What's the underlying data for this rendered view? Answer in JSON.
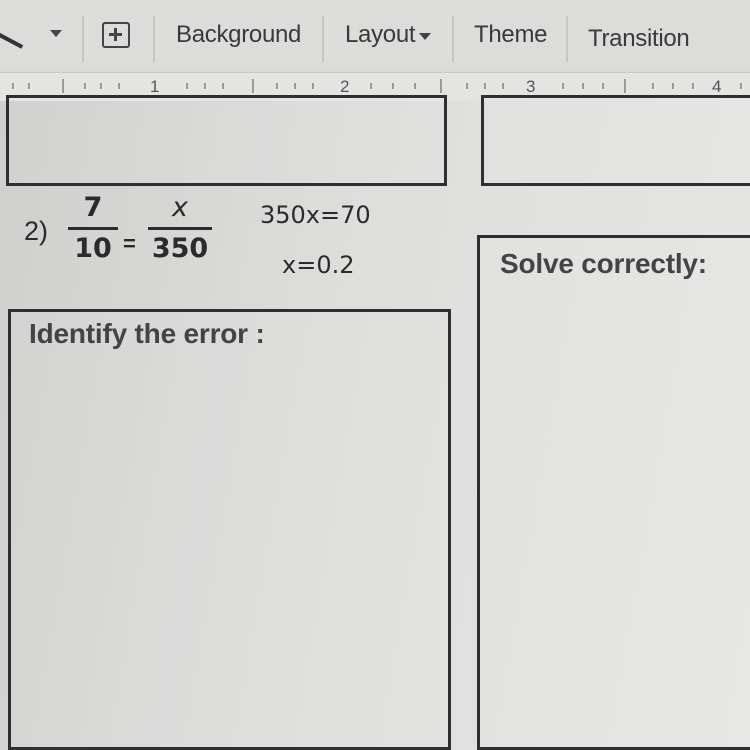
{
  "toolbar": {
    "line_tool_icon": "line-tool-icon",
    "add_icon": "add-box-icon",
    "background_label": "Background",
    "layout_label": "Layout",
    "theme_label": "Theme",
    "transition_label": "Transition"
  },
  "ruler": {
    "marks": [
      "1",
      "2",
      "3",
      "4"
    ]
  },
  "slide": {
    "question_number": "2)",
    "fraction_left": {
      "numerator": "7",
      "denominator": "10"
    },
    "equals": "=",
    "fraction_right": {
      "numerator": "x",
      "denominator": "350"
    },
    "work_line_1": "350x=70",
    "work_line_2": "x=0.2",
    "identify_label": "Identify the error :",
    "solve_label": "Solve correctly:"
  }
}
